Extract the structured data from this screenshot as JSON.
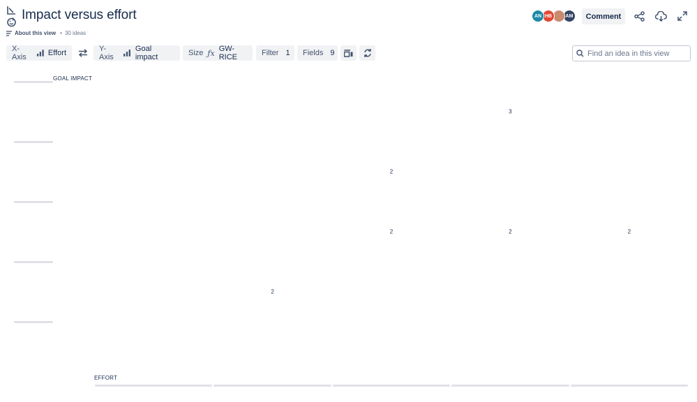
{
  "header": {
    "title": "Impact versus effort",
    "about_label": "About this view",
    "separator": "•",
    "ideas_count": "30 ideas",
    "comment_label": "Comment"
  },
  "avatars": [
    {
      "initials": "AN",
      "color": "#1d8aa6"
    },
    {
      "initials": "HB",
      "color": "#e34935"
    },
    {
      "initials": "",
      "color": "#c98a6e"
    },
    {
      "initials": "AM",
      "color": "#344563"
    }
  ],
  "toolbar": {
    "x_axis_label": "X-Axis",
    "x_axis_value": "Effort",
    "y_axis_label": "Y-Axis",
    "y_axis_value": "Goal impact",
    "size_label": "Size",
    "size_value": "GW-RICE",
    "filter_label": "Filter",
    "filter_count": "1",
    "fields_label": "Fields",
    "fields_count": "9"
  },
  "search": {
    "placeholder": "Find an idea in this view"
  },
  "chart_data": {
    "type": "table",
    "ylabel": "GOAL IMPACT",
    "xlabel": "EFFORT",
    "columns": 5,
    "rows": 5,
    "cells": [
      {
        "col": 4,
        "row": 1,
        "value": "3"
      },
      {
        "col": 3,
        "row": 2,
        "value": "2"
      },
      {
        "col": 3,
        "row": 3,
        "value": "2"
      },
      {
        "col": 4,
        "row": 3,
        "value": "2"
      },
      {
        "col": 5,
        "row": 3,
        "value": "2"
      },
      {
        "col": 2,
        "row": 4,
        "value": "2"
      }
    ]
  }
}
